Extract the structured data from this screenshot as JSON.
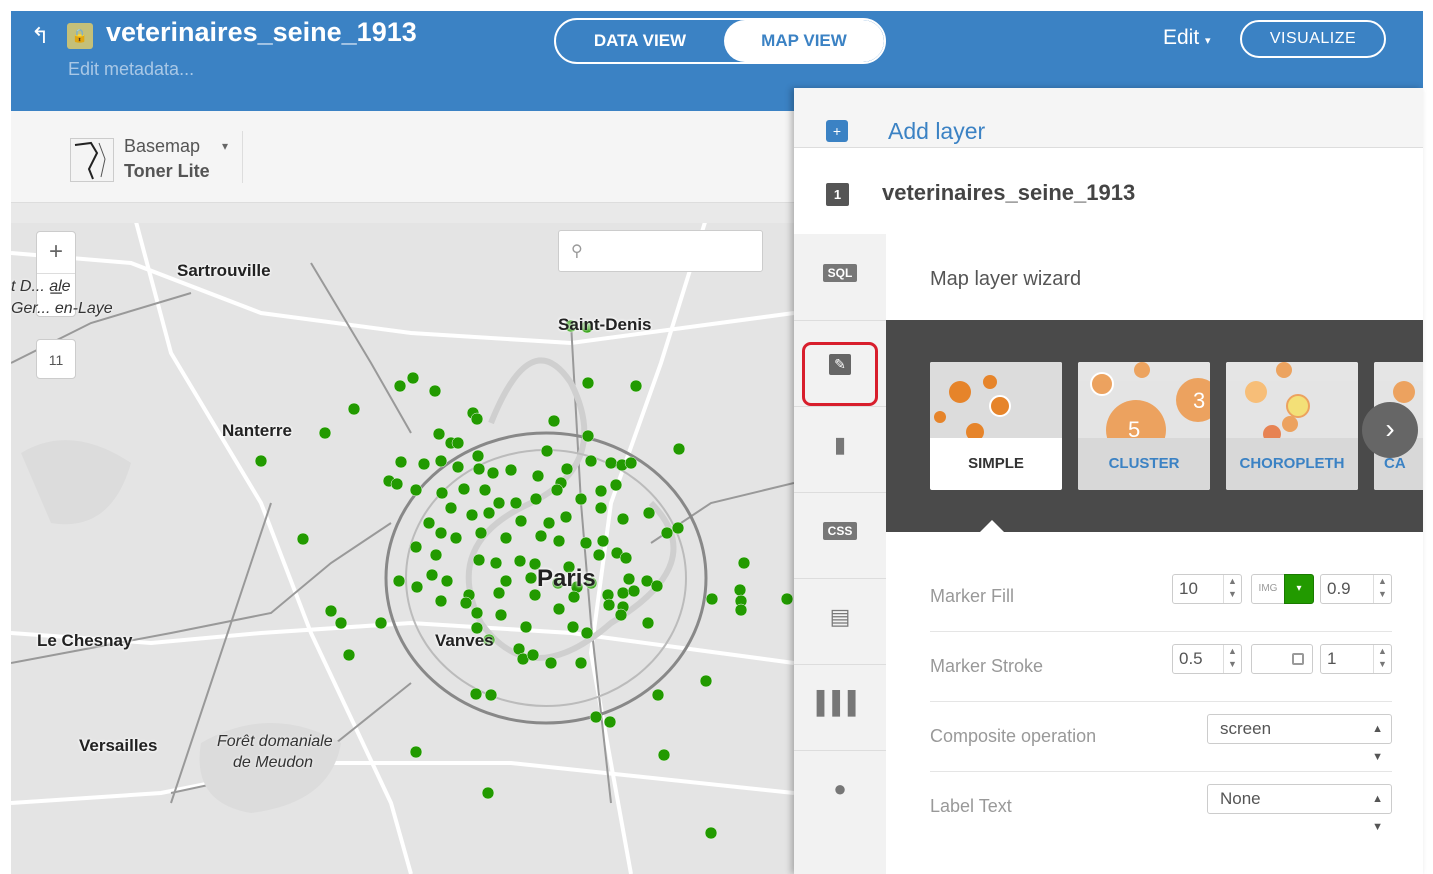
{
  "header": {
    "title": "veterinaires_seine_1913",
    "subtitle": "Edit metadata...",
    "tabs": [
      {
        "label": "DATA VIEW",
        "active": false
      },
      {
        "label": "MAP VIEW",
        "active": true
      }
    ],
    "edit_label": "Edit",
    "visualize_label": "VISUALIZE",
    "back_icon": "back-arrow-icon",
    "lock_icon": "lock-icon",
    "accent_color": "#3b82c4"
  },
  "basemap": {
    "label": "Basemap",
    "value": "Toner Lite"
  },
  "map": {
    "zoom_level": "11",
    "zoom_in": "+",
    "zoom_out": "−",
    "search_placeholder": "",
    "point_color": "#229a00",
    "places": {
      "sartrouville": "Sartrouville",
      "saint_denis": "Saint-Denis",
      "nanterre": "Nanterre",
      "paris": "Paris",
      "le_chesnay": "Le Chesnay",
      "vanves": "Vanves",
      "versailles": "Versailles",
      "foret_line1": "Forêt domaniale",
      "foret_line2": "de Meudon",
      "stgermain_line1": "t D... ale",
      "stgermain_line2": "Ger... en-Laye"
    }
  },
  "panel": {
    "add_layer": "Add layer",
    "layer_number": "1",
    "layer_name": "veterinaires_seine_1913",
    "tools": [
      {
        "name": "sql",
        "label": "SQL"
      },
      {
        "name": "wizard",
        "label": ""
      },
      {
        "name": "infowindow",
        "label": ""
      },
      {
        "name": "css",
        "label": "CSS"
      },
      {
        "name": "legends",
        "label": ""
      },
      {
        "name": "filters",
        "label": ""
      },
      {
        "name": "more",
        "label": ""
      }
    ],
    "highlight_color": "#d81e2c"
  },
  "wizard": {
    "title": "Map layer wizard",
    "types": [
      {
        "label": "SIMPLE",
        "selected": true
      },
      {
        "label": "CLUSTER",
        "selected": false
      },
      {
        "label": "CHOROPLETH",
        "selected": false
      },
      {
        "label": "CA",
        "selected": false
      }
    ],
    "cluster_numbers": [
      "5",
      "3"
    ],
    "properties": {
      "marker_fill": {
        "label": "Marker Fill",
        "size": "10",
        "img": "IMG",
        "opacity": "0.9",
        "color": "#229a00"
      },
      "marker_stroke": {
        "label": "Marker Stroke",
        "width": "0.5",
        "opacity": "1"
      },
      "composite": {
        "label": "Composite operation",
        "value": "screen"
      },
      "label_text": {
        "label": "Label Text",
        "value": "None"
      }
    }
  }
}
